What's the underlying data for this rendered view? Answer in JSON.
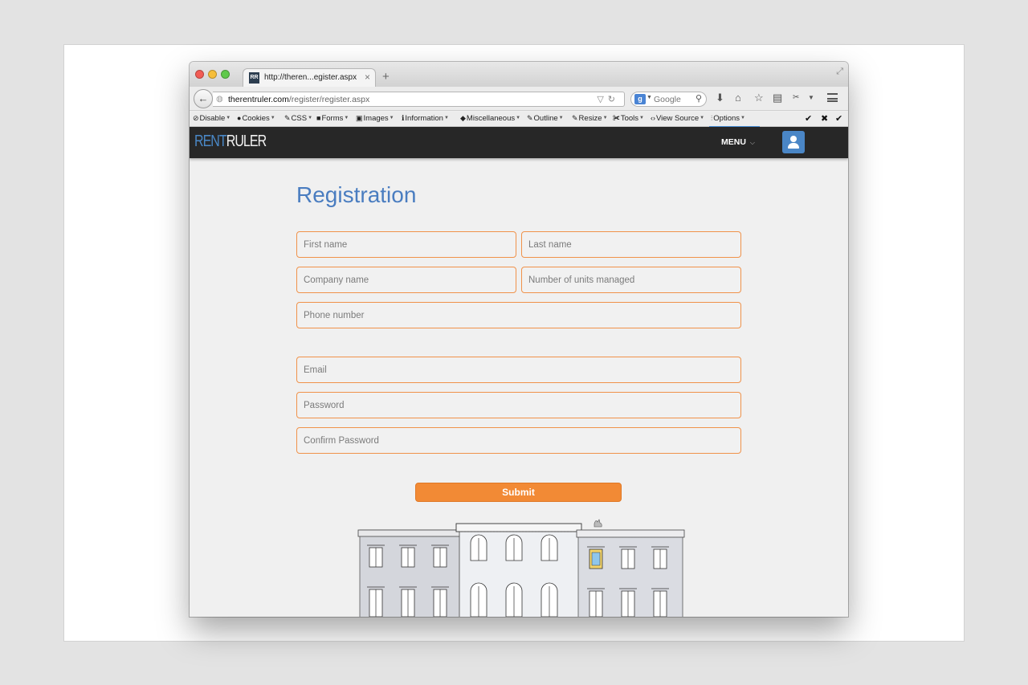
{
  "browser": {
    "tab_title": "http://theren...egister.aspx",
    "tab_close": "×",
    "new_tab": "+",
    "url_host": "therentruler.com",
    "url_path": "/register/register.aspx",
    "search_engine": "Google",
    "search_icon_letter": "g"
  },
  "dev_toolbar": {
    "items": [
      {
        "label": "Disable",
        "icon": "disable-icon"
      },
      {
        "label": "Cookies",
        "icon": "cookies-icon"
      },
      {
        "label": "CSS",
        "icon": "css-icon"
      },
      {
        "label": "Forms",
        "icon": "forms-icon"
      },
      {
        "label": "Images",
        "icon": "images-icon"
      },
      {
        "label": "Information",
        "icon": "information-icon"
      },
      {
        "label": "Miscellaneous",
        "icon": "miscellaneous-icon"
      },
      {
        "label": "Outline",
        "icon": "outline-icon"
      },
      {
        "label": "Resize",
        "icon": "resize-icon"
      },
      {
        "label": "Tools",
        "icon": "tools-icon"
      },
      {
        "label": "View Source",
        "icon": "view-source-icon"
      },
      {
        "label": "Options",
        "icon": "options-icon"
      }
    ]
  },
  "site": {
    "logo_rent": "RENT",
    "logo_ruler": "RULER",
    "menu_label": "MENU",
    "brand_blue": "#4a88c7",
    "accent_orange": "#f28a35"
  },
  "form": {
    "title": "Registration",
    "first_name_placeholder": "First name",
    "last_name_placeholder": "Last name",
    "company_placeholder": "Company name",
    "units_placeholder": "Number of units managed",
    "phone_placeholder": "Phone number",
    "email_placeholder": "Email",
    "password_placeholder": "Password",
    "confirm_password_placeholder": "Confirm Password",
    "submit_label": "Submit"
  }
}
